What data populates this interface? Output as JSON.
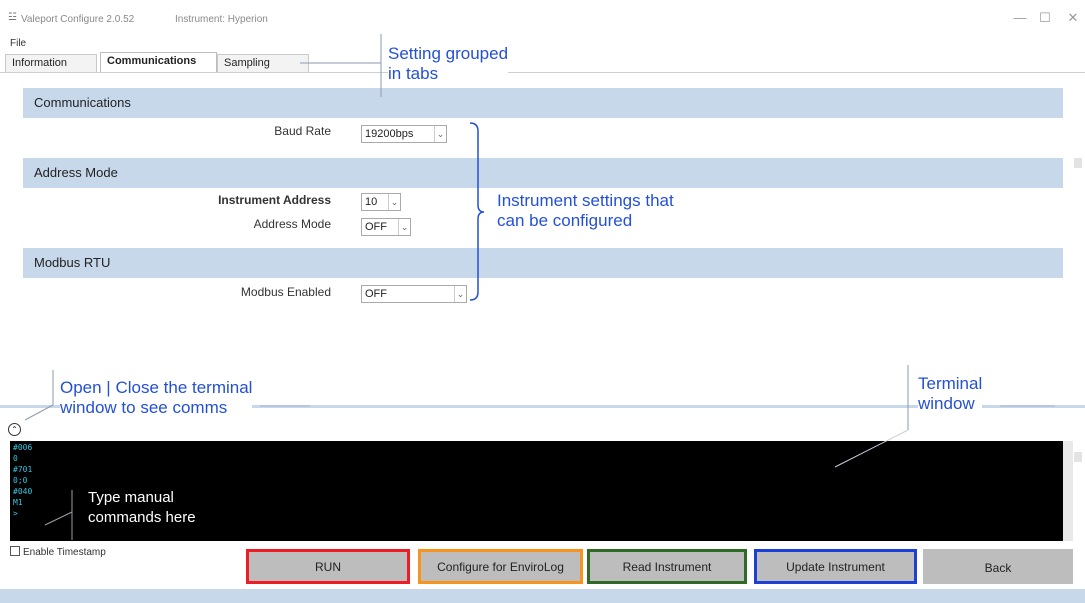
{
  "window": {
    "title": "Valeport Configure 2.0.52",
    "instrument": "Instrument: Hyperion",
    "minimize_glyph": "—",
    "maximize_glyph": "☐",
    "close_glyph": "✕"
  },
  "menu": {
    "file": "File"
  },
  "tabs": [
    {
      "label": "Information",
      "active": false
    },
    {
      "label": "Communications",
      "active": true
    },
    {
      "label": "Sampling",
      "active": false
    }
  ],
  "sections": {
    "communications": {
      "title": "Communications",
      "fields": [
        {
          "label": "Baud Rate",
          "value": "19200bps"
        }
      ]
    },
    "address_mode": {
      "title": "Address Mode",
      "fields": [
        {
          "label": "Instrument Address",
          "value": "10"
        },
        {
          "label": "Address Mode",
          "value": "OFF"
        }
      ]
    },
    "modbus": {
      "title": "Modbus RTU",
      "fields": [
        {
          "label": "Modbus Enabled",
          "value": "OFF"
        }
      ]
    }
  },
  "terminal": {
    "lines": [
      "#006",
      "0",
      "#701",
      "0;0",
      "#040",
      "M1",
      ">"
    ]
  },
  "bottom": {
    "enable_timestamp": "Enable Timestamp",
    "buttons": {
      "run": "RUN",
      "configure": "Configure for EnviroLog",
      "read": "Read Instrument",
      "update": "Update Instrument",
      "back": "Back"
    }
  },
  "annotations": {
    "tabs": [
      "Setting grouped",
      "in tabs"
    ],
    "settings": [
      "Instrument settings that",
      "can be configured"
    ],
    "toggle": [
      "Open | Close the terminal",
      "window to see comms"
    ],
    "terminal": [
      "Terminal",
      "window"
    ],
    "manual": [
      "Type manual",
      "commands here"
    ]
  },
  "colors": {
    "section_header_bg": "#c8d8eb",
    "annotation_blue": "#2450d6",
    "terminal_text": "#38c5e0",
    "run_border": "#ee1c24",
    "configure_border": "#f7941d",
    "read_border": "#2f6b25",
    "update_border": "#1c3fd6"
  },
  "icons": {
    "app": "app-icon",
    "toggle": "chevron-up-circle-icon",
    "dropdown": "chevron-down-icon"
  }
}
